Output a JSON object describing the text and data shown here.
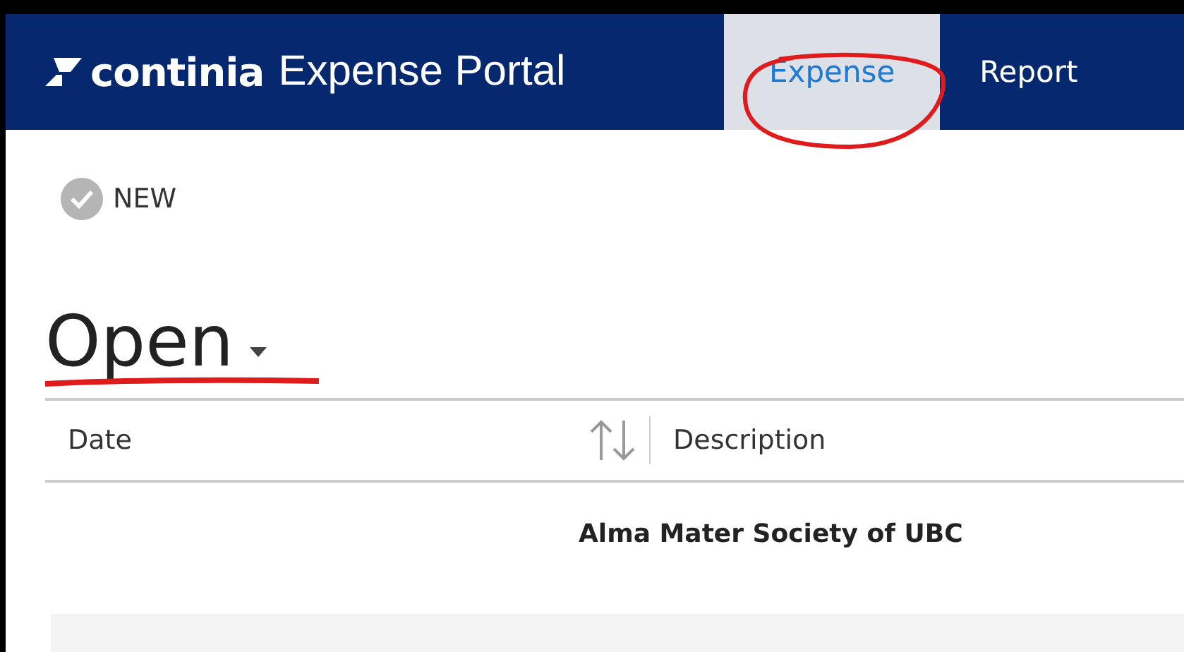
{
  "header": {
    "brand": "continia",
    "product": "Expense Portal"
  },
  "tabs": [
    {
      "label": "Expense",
      "selected": true
    },
    {
      "label": "Report",
      "selected": false
    }
  ],
  "toolbar": {
    "new_button": "NEW"
  },
  "view": {
    "title": "Open"
  },
  "table": {
    "columns": [
      {
        "label": "Date",
        "sortable": true
      },
      {
        "label": "Description",
        "sortable": false
      }
    ],
    "group": "Alma Mater Society of UBC"
  }
}
